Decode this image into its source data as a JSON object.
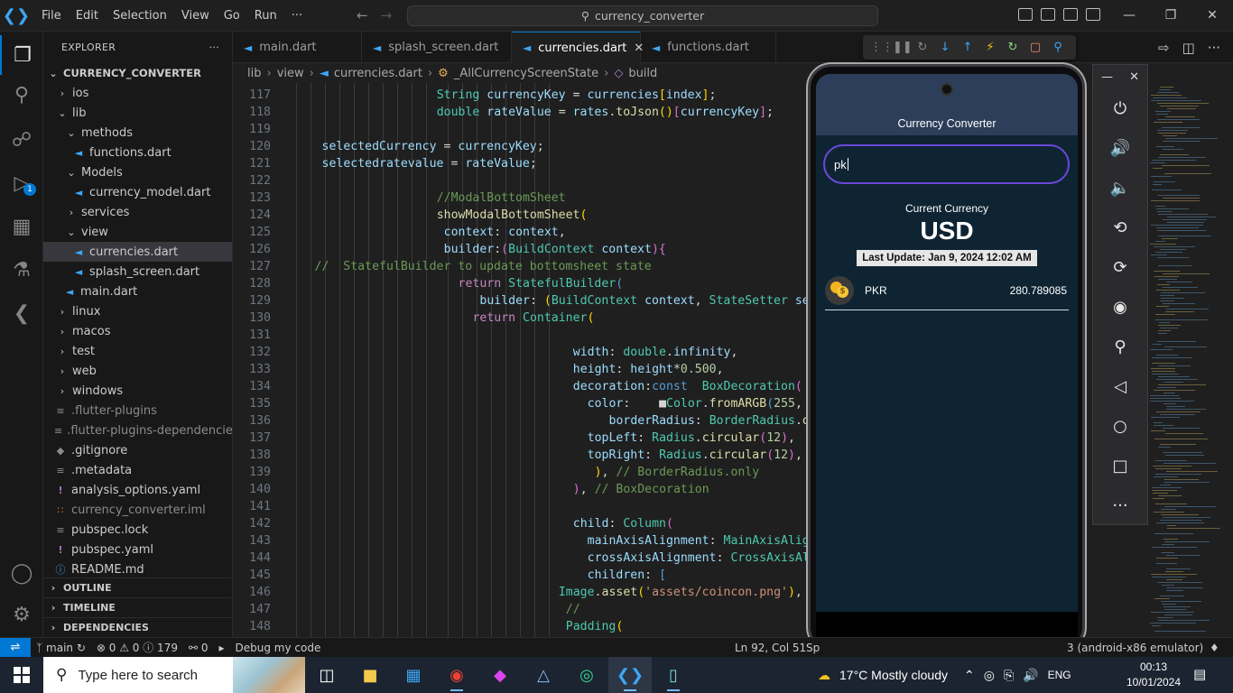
{
  "titlebar": {
    "menu": [
      "File",
      "Edit",
      "Selection",
      "View",
      "Go",
      "Run",
      "···"
    ],
    "search": "currency_converter"
  },
  "sidebar": {
    "title": "EXPLORER",
    "more": "···",
    "project": "CURRENCY_CONVERTER",
    "tree": [
      {
        "label": "ios",
        "indent": 1,
        "kind": "folder-closed"
      },
      {
        "label": "lib",
        "indent": 1,
        "kind": "folder-open"
      },
      {
        "label": "methods",
        "indent": 2,
        "kind": "folder-open"
      },
      {
        "label": "functions.dart",
        "indent": 3,
        "kind": "dart"
      },
      {
        "label": "Models",
        "indent": 2,
        "kind": "folder-open"
      },
      {
        "label": "currency_model.dart",
        "indent": 3,
        "kind": "dart"
      },
      {
        "label": "services",
        "indent": 2,
        "kind": "folder-closed"
      },
      {
        "label": "view",
        "indent": 2,
        "kind": "folder-open"
      },
      {
        "label": "currencies.dart",
        "indent": 3,
        "kind": "dart",
        "selected": true
      },
      {
        "label": "splash_screen.dart",
        "indent": 3,
        "kind": "dart"
      },
      {
        "label": "main.dart",
        "indent": 2,
        "kind": "dart"
      },
      {
        "label": "linux",
        "indent": 1,
        "kind": "folder-closed"
      },
      {
        "label": "macos",
        "indent": 1,
        "kind": "folder-closed"
      },
      {
        "label": "test",
        "indent": 1,
        "kind": "folder-closed"
      },
      {
        "label": "web",
        "indent": 1,
        "kind": "folder-closed"
      },
      {
        "label": "windows",
        "indent": 1,
        "kind": "folder-closed"
      },
      {
        "label": ".flutter-plugins",
        "indent": 1,
        "kind": "lines",
        "dim": true
      },
      {
        "label": ".flutter-plugins-dependencies",
        "indent": 1,
        "kind": "lines",
        "dim": true
      },
      {
        "label": ".gitignore",
        "indent": 1,
        "kind": "git"
      },
      {
        "label": ".metadata",
        "indent": 1,
        "kind": "lines"
      },
      {
        "label": "analysis_options.yaml",
        "indent": 1,
        "kind": "yaml"
      },
      {
        "label": "currency_converter.iml",
        "indent": 1,
        "kind": "xml",
        "dim": true
      },
      {
        "label": "pubspec.lock",
        "indent": 1,
        "kind": "lines"
      },
      {
        "label": "pubspec.yaml",
        "indent": 1,
        "kind": "yaml"
      },
      {
        "label": "README.md",
        "indent": 1,
        "kind": "info"
      }
    ],
    "sections": [
      "OUTLINE",
      "TIMELINE",
      "DEPENDENCIES"
    ]
  },
  "tabs": [
    {
      "label": "main.dart",
      "active": false
    },
    {
      "label": "splash_screen.dart",
      "active": false
    },
    {
      "label": "currencies.dart",
      "active": true
    },
    {
      "label": "functions.dart",
      "active": false
    }
  ],
  "breadcrumb": [
    "lib",
    "view",
    "currencies.dart",
    "_AllCurrencyScreenState",
    "build"
  ],
  "editor": {
    "lines": [
      {
        "n": "117",
        "indent": 26,
        "html": "<span class='tp'>String</span> <span class='vr'>currencyKey</span> <span class='pl'>=</span> <span class='vr'>currencies</span><span class='pb'>[</span><span class='vr'>index</span><span class='pb'>]</span><span class='pl'>;</span>"
      },
      {
        "n": "118",
        "indent": 26,
        "html": "<span class='tp'>double</span> <span class='vr'>rateValue</span> <span class='pl'>=</span> <span class='vr'>rates</span><span class='pl'>.</span><span class='fn'>toJson</span><span class='pb'>()</span><span class='pp'>[</span><span class='vr'>currencyKey</span><span class='pp'>]</span><span class='pl'>;</span>"
      },
      {
        "n": "119",
        "indent": 0,
        "html": ""
      },
      {
        "n": "120",
        "indent": 10,
        "html": "<span class='vr'>selectedCurrency</span> <span class='pl'>=</span> <span class='vr'>currencyKey</span><span class='pl'>;</span>"
      },
      {
        "n": "121",
        "indent": 10,
        "html": "<span class='vr'>selectedratevalue</span> <span class='pl'>=</span> <span class='vr'>rateValue</span><span class='pl'>;</span>"
      },
      {
        "n": "122",
        "indent": 0,
        "html": ""
      },
      {
        "n": "123",
        "indent": 26,
        "html": "<span class='cm'>//ModalBottomSheet</span>"
      },
      {
        "n": "124",
        "indent": 26,
        "html": "<span class='fn'>showModalBottomSheet</span><span class='pb'>(</span>"
      },
      {
        "n": "125",
        "indent": 27,
        "html": "<span class='vr'>context</span><span class='pl'>:</span> <span class='vr'>context</span><span class='pl'>,</span>"
      },
      {
        "n": "126",
        "indent": 27,
        "html": "<span class='vr'>builder</span><span class='pl'>:</span><span class='pp'>(</span><span class='tp'>BuildContext</span> <span class='vr'>context</span><span class='pp'>)</span><span class='pp'>{</span>"
      },
      {
        "n": "127",
        "indent": 9,
        "html": "<span class='cm'>//  StatefulBuilder to update bottomsheet state</span>"
      },
      {
        "n": "128",
        "indent": 29,
        "html": "<span class='kw'>return</span> <span class='tp'>StatefulBuilder</span><span class='blu'>(</span>"
      },
      {
        "n": "129",
        "indent": 32,
        "html": "<span class='vr'>builder</span><span class='pl'>:</span> <span class='pb'>(</span><span class='tp'>BuildContext</span> <span class='vr'>context</span><span class='pl'>,</span> <span class='tp'>StateSetter</span> <span class='vr'>setSta</span>"
      },
      {
        "n": "130",
        "indent": 31,
        "html": "<span class='kw'>return</span> <span class='tp'>Container</span><span class='pb'>(</span>"
      },
      {
        "n": "131",
        "indent": 0,
        "html": ""
      },
      {
        "n": "132",
        "indent": 45,
        "html": "<span class='vr'>width</span><span class='pl'>:</span> <span class='tp'>double</span><span class='pl'>.</span><span class='vr'>infinity</span><span class='pl'>,</span>"
      },
      {
        "n": "133",
        "indent": 45,
        "html": "<span class='vr'>height</span><span class='pl'>:</span> <span class='vr'>height</span><span class='pl'>*</span><span class='nm'>0.500</span><span class='pl'>,</span>"
      },
      {
        "n": "134",
        "indent": 45,
        "html": "<span class='vr'>decoration</span><span class='pl'>:</span><span class='blu'>const</span>  <span class='tp'>BoxDecoration</span><span class='pp'>(</span>"
      },
      {
        "n": "135",
        "indent": 47,
        "html": "<span class='vr'>color</span><span class='pl'>:</span>    <span class='pl'>&#9632;</span><span class='tp'>Color</span><span class='pl'>.</span><span class='fn'>fromARGB</span><span class='blu'>(</span><span class='nm'>255</span><span class='pl'>,</span> <span class='nm'>85</span><span class='pl'>,</span>"
      },
      {
        "n": "136",
        "indent": 50,
        "html": "<span class='vr'>borderRadius</span><span class='pl'>:</span> <span class='tp'>BorderRadius</span><span class='pl'>.</span><span class='fn'>only</span><span class='pb'>(</span>"
      },
      {
        "n": "137",
        "indent": 47,
        "html": "<span class='vr'>topLeft</span><span class='pl'>:</span> <span class='tp'>Radius</span><span class='pl'>.</span><span class='fn'>circular</span><span class='pp'>(</span><span class='nm'>12</span><span class='pp'>)</span><span class='pl'>,</span>"
      },
      {
        "n": "138",
        "indent": 47,
        "html": "<span class='vr'>topRight</span><span class='pl'>:</span> <span class='tp'>Radius</span><span class='pl'>.</span><span class='fn'>circular</span><span class='pp'>(</span><span class='nm'>12</span><span class='pp'>)</span><span class='pl'>,</span>"
      },
      {
        "n": "139",
        "indent": 48,
        "html": "<span class='pb'>)</span><span class='pl'>,</span> <span class='cm'>// BorderRadius.only</span>"
      },
      {
        "n": "140",
        "indent": 45,
        "html": "<span class='pp'>)</span><span class='pl'>,</span> <span class='cm'>// BoxDecoration</span>"
      },
      {
        "n": "141",
        "indent": 0,
        "html": ""
      },
      {
        "n": "142",
        "indent": 45,
        "html": "<span class='vr'>child</span><span class='pl'>:</span> <span class='tp'>Column</span><span class='pp'>(</span>"
      },
      {
        "n": "143",
        "indent": 47,
        "html": "<span class='vr'>mainAxisAlignment</span><span class='pl'>:</span> <span class='tp'>MainAxisAlignmen</span>"
      },
      {
        "n": "144",
        "indent": 47,
        "html": "<span class='vr'>crossAxisAlignment</span><span class='pl'>:</span> <span class='tp'>CrossAxisAlignm</span>"
      },
      {
        "n": "145",
        "indent": 47,
        "html": "<span class='vr'>children</span><span class='pl'>:</span> <span class='blu'>[</span>"
      },
      {
        "n": "146",
        "indent": 43,
        "html": "<span class='tp'>Image</span><span class='pl'>.</span><span class='fn'>asset</span><span class='pb'>(</span><span class='st'>'assets/coincon.png'</span><span class='pb'>)</span><span class='pl'>,</span>"
      },
      {
        "n": "147",
        "indent": 44,
        "html": "<span class='cm'>//</span>"
      },
      {
        "n": "148",
        "indent": 44,
        "html": "<span class='tp'>Padding</span><span class='pb'>(</span>"
      }
    ]
  },
  "emulator": {
    "app_title": "Currency Converter",
    "search_value": "pk",
    "current_label": "Current Currency",
    "current_code": "USD",
    "last_update": "Last Update: Jan 9, 2024 12:02 AM",
    "rate_code": "PKR",
    "rate_value": "280.789085"
  },
  "statusbar": {
    "branch": "main",
    "problems": "⊗ 0 ⚠ 0 ⓘ 179",
    "ports": "⚯ 0",
    "debug": "Debug my code",
    "position": "Ln 92, Col 51",
    "spaces_frag": "Sp",
    "device": "3 (android-x86 emulator)"
  },
  "taskbar": {
    "search_placeholder": "Type here to search",
    "weather": "17°C  Mostly cloudy",
    "lang": "ENG",
    "time": "00:13",
    "date": "10/01/2024"
  }
}
